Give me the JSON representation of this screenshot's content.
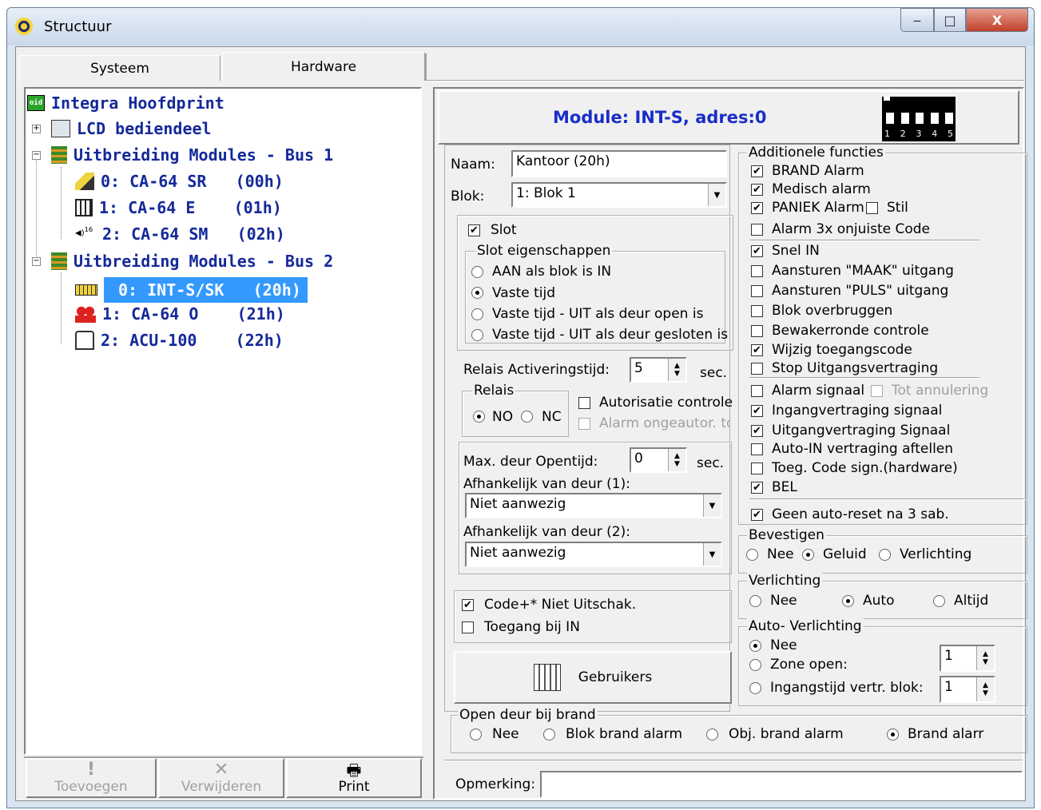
{
  "window": {
    "title": "Structuur",
    "minimize": "‒",
    "maximize": "□",
    "close": "X"
  },
  "tabs": [
    {
      "label": "Systeem"
    },
    {
      "label": "Hardware"
    }
  ],
  "tree": {
    "root": "Integra Hoofdprint",
    "lcd": "LCD bediendeel",
    "bus1": "Uitbreiding Modules - Bus 1",
    "bus1_items": [
      {
        "label": "0: CA-64 SR   (00h)"
      },
      {
        "label": "1: CA-64 E    (01h)"
      },
      {
        "label": "2: CA-64 SM   (02h)"
      }
    ],
    "bus2": "Uitbreiding Modules - Bus 2",
    "bus2_items": [
      {
        "label": "0: INT-S/SK   (20h)"
      },
      {
        "label": "1: CA-64 O    (21h)"
      },
      {
        "label": "2: ACU-100    (22h)"
      }
    ],
    "icon_badge": "16"
  },
  "bottom_buttons": {
    "add": "Toevoegen",
    "remove": "Verwijderen",
    "print": "Print"
  },
  "header": {
    "module_title": "Module: INT-S, adres:0",
    "dip_labels": [
      "1",
      "2",
      "3",
      "4",
      "5"
    ],
    "dip_state": "off"
  },
  "form": {
    "naam_label": "Naam:",
    "naam_value": "Kantoor  (20h)",
    "blok_label": "Blok:",
    "blok_value": "1: Blok  1",
    "slot_label": "Slot",
    "slot_group_label": "Slot eigenschappen",
    "slot_options": [
      "AAN als blok is IN",
      "Vaste tijd",
      "Vaste tijd - UIT als deur open is",
      "Vaste tijd - UIT als deur gesloten is"
    ],
    "relais_time_label": "Relais Activeringstijd:",
    "relais_time_value": "5",
    "sec": "sec.",
    "relais_group_label": "Relais",
    "relais_no": "NO",
    "relais_nc": "NC",
    "autorisatie": "Autorisatie controle",
    "alarm_ongeautor": "Alarm ongeautor. toe",
    "max_deur_label": "Max. deur Opentijd:",
    "max_deur_value": "0",
    "afh1_label": "Afhankelijk van deur (1):",
    "afh1_value": "Niet aanwezig",
    "afh2_label": "Afhankelijk van deur (2):",
    "afh2_value": "Niet aanwezig",
    "code_niet_uitschak": "Code+* Niet Uitschak.",
    "toegang_bij_in": "Toegang bij IN",
    "gebruikers": "Gebruikers",
    "open_deur_label": "Open deur bij brand",
    "open_deur_options": [
      "Nee",
      "Blok brand alarm",
      "Obj. brand alarm",
      "Brand alarr"
    ],
    "opmerking_label": "Opmerking:",
    "opmerking_value": ""
  },
  "additionele": {
    "label": "Additionele functies",
    "items": [
      {
        "label": "BRAND Alarm",
        "checked": "✔"
      },
      {
        "label": "Medisch alarm",
        "checked": "✔"
      },
      {
        "label": "PANIEK Alarm",
        "checked": "✔"
      },
      {
        "label": "Alarm 3x onjuiste Code",
        "checked": ""
      },
      {
        "label": "Snel IN",
        "checked": "✔"
      },
      {
        "label": "Aansturen \"MAAK\" uitgang",
        "checked": ""
      },
      {
        "label": "Aansturen \"PULS\" uitgang",
        "checked": ""
      },
      {
        "label": "Blok overbruggen",
        "checked": ""
      },
      {
        "label": "Bewakerronde controle",
        "checked": ""
      },
      {
        "label": "Wijzig toegangscode",
        "checked": "✔"
      },
      {
        "label": "Stop Uitgangsvertraging",
        "checked": ""
      },
      {
        "label": "Alarm signaal",
        "checked": ""
      },
      {
        "label": "Ingangvertraging signaal",
        "checked": "✔"
      },
      {
        "label": "Uitgangvertraging Signaal",
        "checked": "✔"
      },
      {
        "label": "Auto-IN vertraging aftellen",
        "checked": ""
      },
      {
        "label": "Toeg. Code sign.(hardware)",
        "checked": ""
      },
      {
        "label": "BEL",
        "checked": "✔"
      },
      {
        "label": "Geen auto-reset na 3 sab.",
        "checked": "✔"
      }
    ],
    "stil": "Stil",
    "tot_annulering": "Tot annulering"
  },
  "bevestigen": {
    "label": "Bevestigen",
    "options": [
      "Nee",
      "Geluid",
      "Verlichting"
    ]
  },
  "verlichting": {
    "label": "Verlichting",
    "options": [
      "Nee",
      "Auto",
      "Altijd"
    ]
  },
  "auto_verlichting": {
    "label": "Auto- Verlichting",
    "options": [
      "Nee",
      "Zone open:",
      "Ingangstijd vertr. blok:"
    ],
    "zone_value": "1",
    "blok_value": "1"
  }
}
